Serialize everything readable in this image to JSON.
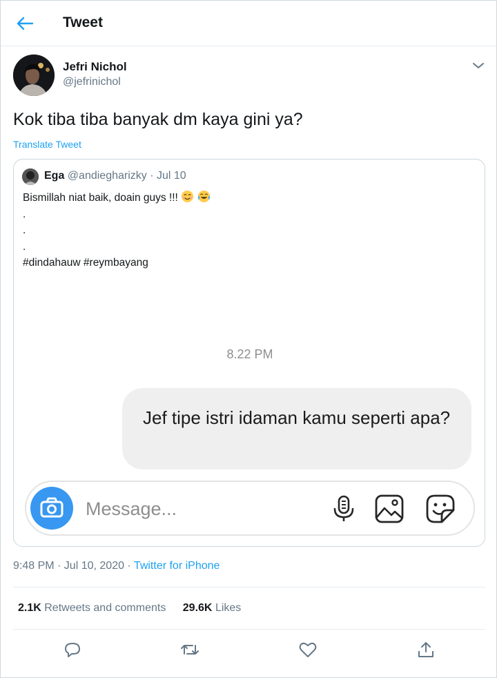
{
  "header": {
    "title": "Tweet",
    "back_icon": "arrow-left-icon"
  },
  "author": {
    "name": "Jefri Nichol",
    "handle": "@jefrinichol"
  },
  "tweet": {
    "text": "Kok tiba tiba banyak dm kaya gini ya?",
    "translate_label": "Translate Tweet"
  },
  "quoted": {
    "name": "Ega",
    "handle_date": "@andiegharizky · Jul 10",
    "line1": "Bismillah niat baik, doain guys !!!",
    "emojis": [
      "smiling-face-icon",
      "tears-of-joy-icon"
    ],
    "dot_lines": [
      ".",
      ".",
      "."
    ],
    "hashtags": "#dindahauw #reymbayang",
    "dm": {
      "time": "8.22 PM",
      "message": "Jef tipe istri idaman kamu seperti apa?",
      "placeholder": "Message..."
    }
  },
  "meta": {
    "timestamp": "9:48 PM · Jul 10, 2020 · ",
    "source": "Twitter for iPhone"
  },
  "stats": {
    "retweets_count": "2.1K",
    "retweets_label": "Retweets and comments",
    "likes_count": "29.6K",
    "likes_label": "Likes"
  },
  "colors": {
    "link": "#1da1f2",
    "muted": "#657786",
    "camera": "#3897f0"
  }
}
